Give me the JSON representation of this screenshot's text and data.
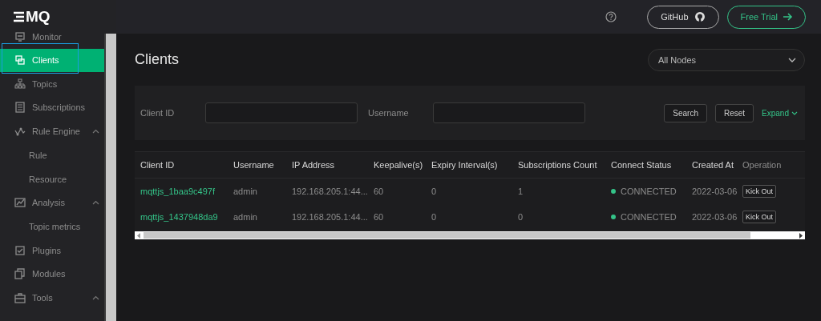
{
  "logo": {
    "text": "MQ"
  },
  "sidebar": {
    "items": [
      {
        "label": "Monitor",
        "selected": false
      },
      {
        "label": "Clients",
        "selected": true
      },
      {
        "label": "Topics",
        "selected": false
      },
      {
        "label": "Subscriptions",
        "selected": false
      },
      {
        "label": "Rule Engine",
        "selected": false,
        "expanded": true,
        "children": [
          {
            "label": "Rule",
            "selected": false
          },
          {
            "label": "Resource",
            "selected": false
          }
        ]
      },
      {
        "label": "Analysis",
        "selected": false,
        "expanded": true,
        "children": [
          {
            "label": "Topic metrics",
            "selected": false
          }
        ]
      },
      {
        "label": "Plugins",
        "selected": false
      },
      {
        "label": "Modules",
        "selected": false
      },
      {
        "label": "Tools",
        "selected": false,
        "expanded": true
      }
    ]
  },
  "header": {
    "github": "GitHub",
    "free_trial": "Free Trial"
  },
  "page": {
    "title": "Clients",
    "node_select": "All Nodes"
  },
  "filters": {
    "fields": [
      {
        "label": "Client ID"
      },
      {
        "label": "Username"
      }
    ],
    "search": "Search",
    "reset": "Reset",
    "expand": "Expand"
  },
  "table": {
    "columns": [
      "Client ID",
      "Username",
      "IP Address",
      "Keepalive(s)",
      "Expiry Interval(s)",
      "Subscriptions Count",
      "Connect Status",
      "Created At",
      "Operation"
    ],
    "rows": [
      {
        "client_id": "mqttjs_1baa9c497f",
        "username": "admin",
        "ip": "192.168.205.1:44...",
        "keepalive": "60",
        "expiry": "0",
        "subscriptions": "1",
        "status": "CONNECTED",
        "created": "2022-03-06",
        "action": "Kick Out"
      },
      {
        "client_id": "mqttjs_1437948da9",
        "username": "admin",
        "ip": "192.168.205.1:44...",
        "keepalive": "60",
        "expiry": "0",
        "subscriptions": "0",
        "status": "CONNECTED",
        "created": "2022-03-06",
        "action": "Kick Out"
      }
    ]
  }
}
